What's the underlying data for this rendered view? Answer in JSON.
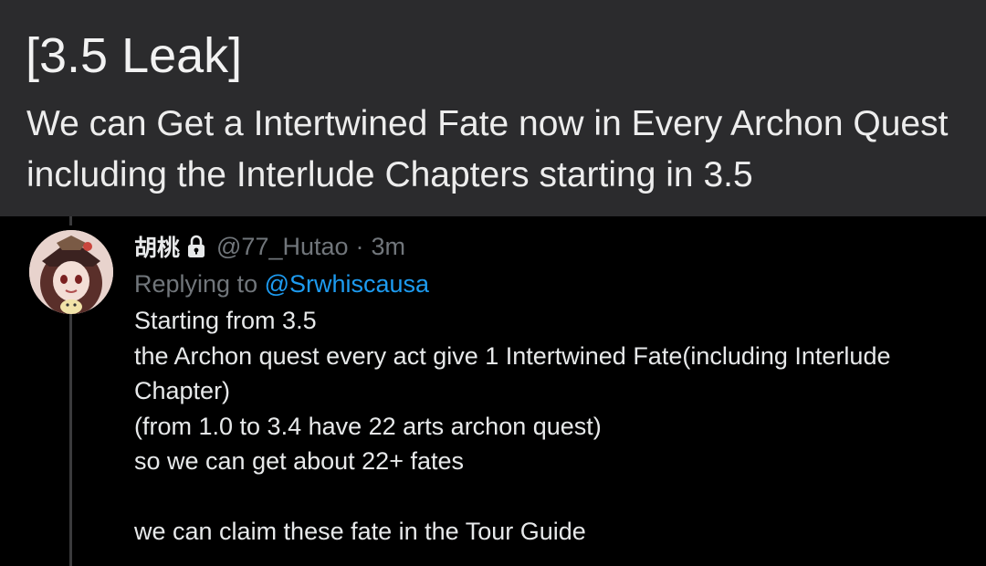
{
  "header": {
    "title": "[3.5 Leak]",
    "subtitle": "We can Get a Intertwined Fate now in Every Archon Quest including the Interlude Chapters starting in 3.5"
  },
  "tweet": {
    "author_name": "胡桃",
    "handle": "@77_Hutao",
    "separator": "·",
    "time": "3m",
    "replying_to_prefix": "Replying to ",
    "replying_to_handle": "@Srwhiscausa",
    "lines": [
      "Starting from 3.5",
      "the Archon quest every act give 1 Intertwined Fate(including Interlude",
      "Chapter)",
      "(from 1.0 to 3.4 have 22 arts archon quest)",
      "so we can get about 22+ fates",
      "",
      "we can claim these fate in the Tour Guide"
    ]
  },
  "icons": {
    "lock": "lock-icon",
    "avatar": "avatar"
  },
  "colors": {
    "header_bg": "#2b2b2d",
    "tweet_bg": "#000000",
    "text_primary": "#e7e9ea",
    "text_secondary": "#71767b",
    "link": "#1d9bf0"
  }
}
